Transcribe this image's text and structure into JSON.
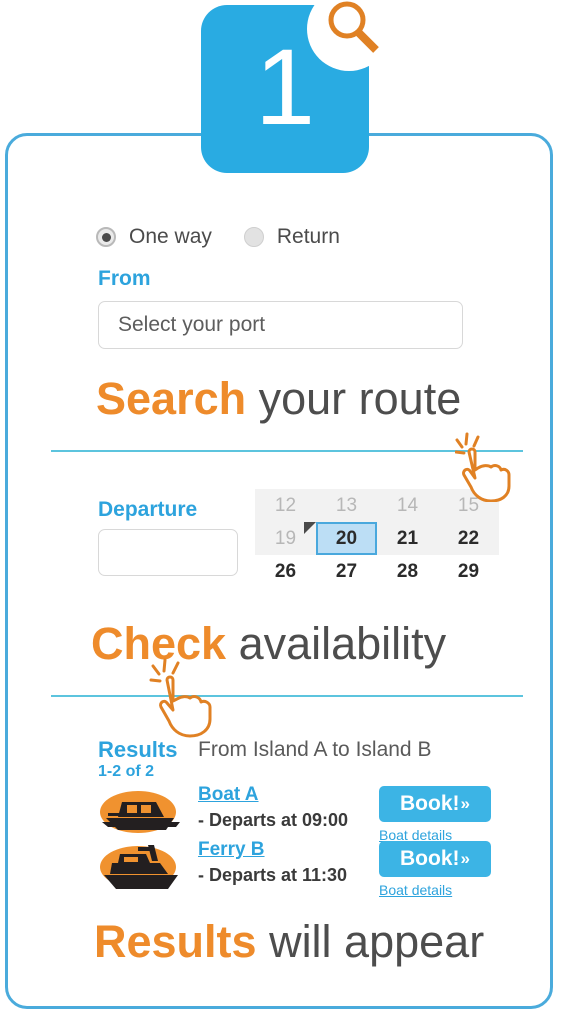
{
  "badge": {
    "number": "1",
    "icon": "magnifier-icon",
    "color": "#29abe2",
    "icon_color": "#e08124"
  },
  "card": {
    "border_color": "#4aabdc"
  },
  "trip_type": {
    "options": [
      {
        "label": "One way",
        "selected": true
      },
      {
        "label": "Return",
        "selected": false
      }
    ]
  },
  "from": {
    "label": "From",
    "placeholder": "Select your port",
    "value": ""
  },
  "departure": {
    "label": "Departure",
    "placeholder": "",
    "value": ""
  },
  "cursors": {
    "from_cursor": "pointing-hand-cursor",
    "departure_cursor": "pointing-hand-cursor"
  },
  "headlines": [
    {
      "strong": "Search",
      "rest": " your route"
    },
    {
      "strong": "Check",
      "rest": " availability"
    },
    {
      "strong": "Results",
      "rest": " will appear"
    }
  ],
  "calendar": {
    "rows": [
      [
        {
          "day": "12",
          "state": "muted"
        },
        {
          "day": "13",
          "state": "muted"
        },
        {
          "day": "14",
          "state": "muted"
        },
        {
          "day": "15",
          "state": "muted"
        }
      ],
      [
        {
          "day": "19",
          "state": "muted"
        },
        {
          "day": "20",
          "state": "selected"
        },
        {
          "day": "21",
          "state": "normal"
        },
        {
          "day": "22",
          "state": "normal"
        }
      ],
      [
        {
          "day": "26",
          "state": "normal"
        },
        {
          "day": "27",
          "state": "normal"
        },
        {
          "day": "28",
          "state": "normal"
        },
        {
          "day": "29",
          "state": "normal"
        }
      ]
    ],
    "selected_day": "20",
    "selected_bg": "#bcdef5",
    "selected_border": "#49a8dd"
  },
  "results": {
    "title": "Results",
    "count": "1-2 of 2",
    "route": "From Island A to Island B",
    "rows": [
      {
        "name": "Boat A",
        "departs": "- Departs at 09:00",
        "book_label": "Book!",
        "book_chevron": "»",
        "details_label": "Boat details",
        "icon": "speedboat-icon"
      },
      {
        "name": "Ferry B",
        "departs": "- Departs at 11:30",
        "book_label": "Book!",
        "book_chevron": "»",
        "details_label": "Boat details",
        "icon": "ferry-icon"
      }
    ]
  },
  "colors": {
    "brand_blue": "#29abe2",
    "link_blue": "#2da3dd",
    "accent_orange": "#ee8b2b",
    "divider": "#5cc4de",
    "text_dark": "#4d4d4d"
  }
}
